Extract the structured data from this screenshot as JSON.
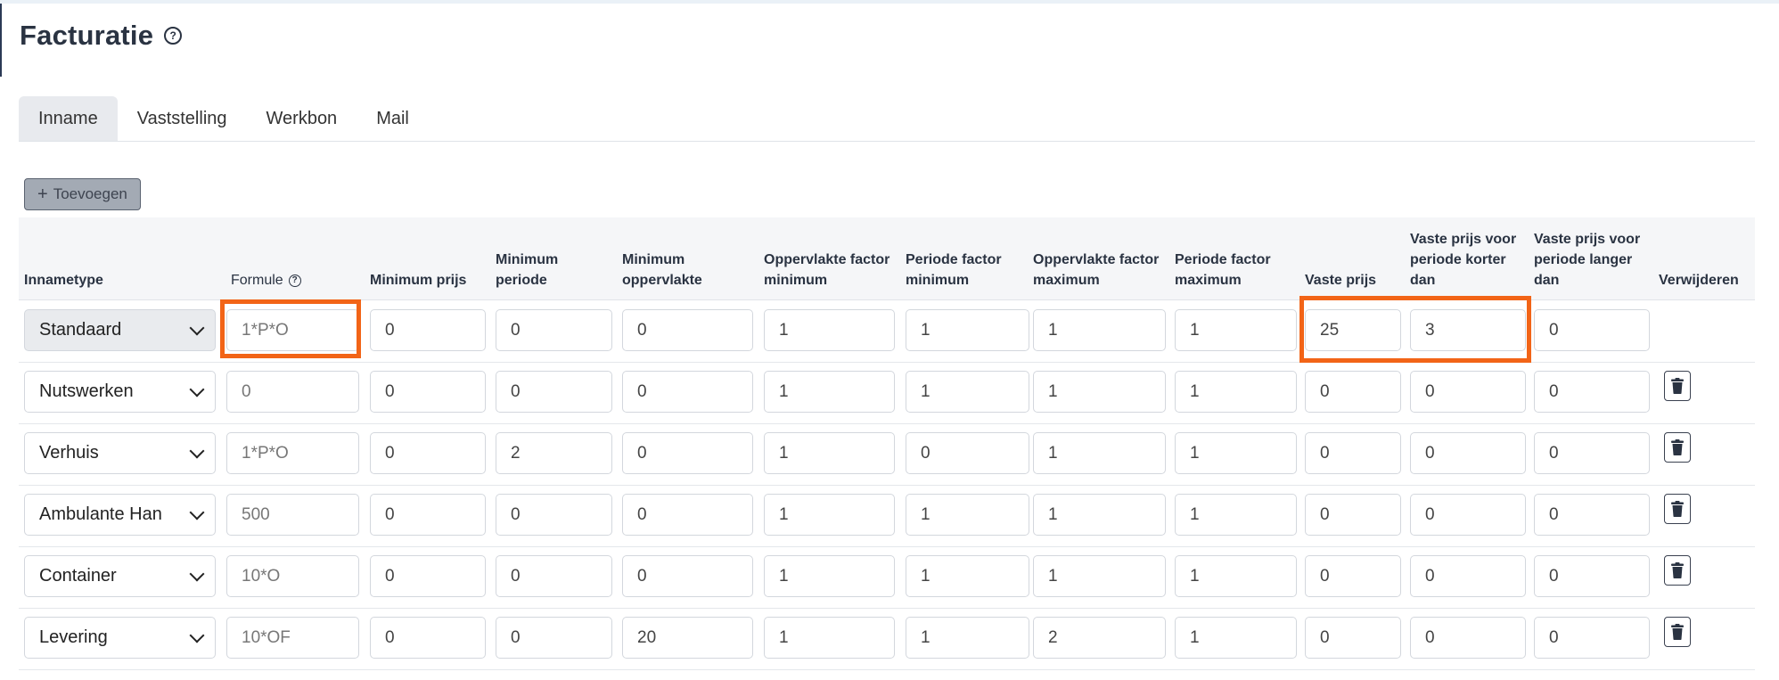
{
  "page": {
    "title": "Facturatie",
    "help_icon": "question-circle-icon"
  },
  "tabs": [
    {
      "label": "Inname",
      "active": true
    },
    {
      "label": "Vaststelling",
      "active": false
    },
    {
      "label": "Werkbon",
      "active": false
    },
    {
      "label": "Mail",
      "active": false
    }
  ],
  "add_button": {
    "icon": "plus-icon",
    "label": "Toevoegen"
  },
  "columns": [
    "Innametype",
    "Formule",
    "Minimum prijs",
    "Minimum periode",
    "Minimum oppervlakte",
    "Oppervlakte factor minimum",
    "Periode factor minimum",
    "Oppervlakte factor maximum",
    "Periode factor maximum",
    "Vaste prijs",
    "Vaste prijs voor periode korter dan",
    "Vaste prijs voor periode langer dan",
    "Verwijderen"
  ],
  "rows": [
    {
      "type": "Standaard",
      "values": [
        "1*P*O",
        "0",
        "0",
        "0",
        "1",
        "1",
        "1",
        "1",
        "25",
        "3",
        "0"
      ],
      "deletable": false
    },
    {
      "type": "Nutswerken",
      "values": [
        "0",
        "0",
        "0",
        "0",
        "1",
        "1",
        "1",
        "1",
        "0",
        "0",
        "0"
      ],
      "deletable": true
    },
    {
      "type": "Verhuis",
      "values": [
        "1*P*O",
        "0",
        "2",
        "0",
        "1",
        "0",
        "1",
        "1",
        "0",
        "0",
        "0"
      ],
      "deletable": true
    },
    {
      "type": "Ambulante Han",
      "values": [
        "500",
        "0",
        "0",
        "0",
        "1",
        "1",
        "1",
        "1",
        "0",
        "0",
        "0"
      ],
      "deletable": true
    },
    {
      "type": "Container",
      "values": [
        "10*O",
        "0",
        "0",
        "0",
        "1",
        "1",
        "1",
        "1",
        "0",
        "0",
        "0"
      ],
      "deletable": true
    },
    {
      "type": "Levering",
      "values": [
        "10*OF",
        "0",
        "0",
        "20",
        "1",
        "1",
        "2",
        "1",
        "0",
        "0",
        "0"
      ],
      "deletable": true
    }
  ],
  "icons": {
    "delete": "trash-icon",
    "dropdown": "chevron-down-icon"
  },
  "colors": {
    "highlight": "#f26417"
  }
}
